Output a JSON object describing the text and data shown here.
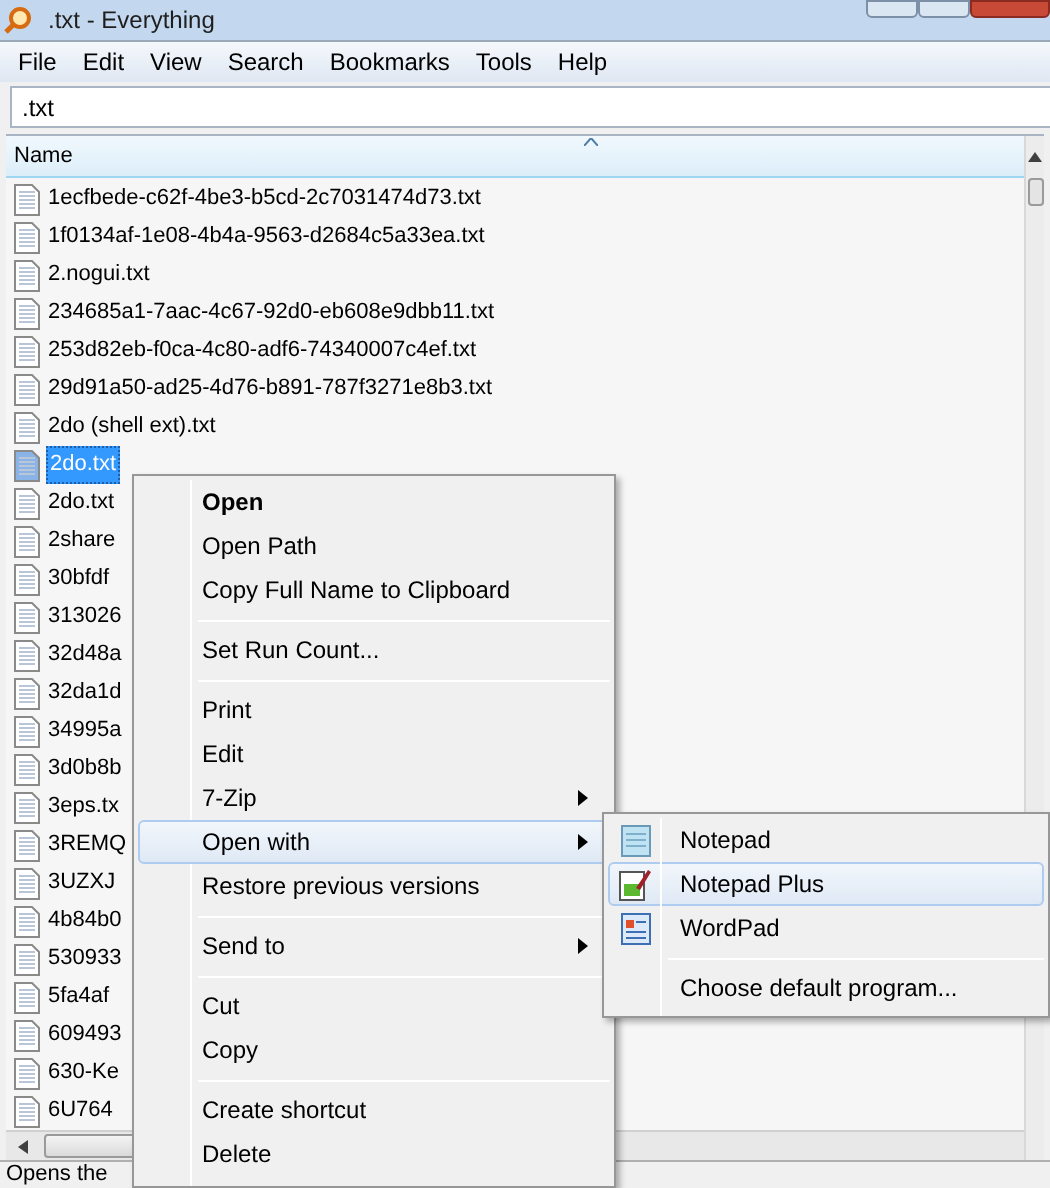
{
  "window": {
    "title": ".txt - Everything"
  },
  "menu_bar": [
    "File",
    "Edit",
    "View",
    "Search",
    "Bookmarks",
    "Tools",
    "Help"
  ],
  "search": {
    "value": ".txt"
  },
  "table": {
    "columns": [
      "Name"
    ],
    "rows": [
      {
        "name": "1ecfbede-c62f-4be3-b5cd-2c7031474d73.txt",
        "selected": false
      },
      {
        "name": "1f0134af-1e08-4b4a-9563-d2684c5a33ea.txt",
        "selected": false
      },
      {
        "name": "2.nogui.txt",
        "selected": false
      },
      {
        "name": "234685a1-7aac-4c67-92d0-eb608e9dbb11.txt",
        "selected": false
      },
      {
        "name": "253d82eb-f0ca-4c80-adf6-74340007c4ef.txt",
        "selected": false
      },
      {
        "name": "29d91a50-ad25-4d76-b891-787f3271e8b3.txt",
        "selected": false
      },
      {
        "name": "2do (shell ext).txt",
        "selected": false
      },
      {
        "name": "2do.txt",
        "selected": true
      },
      {
        "name": "2do.txt",
        "selected": false
      },
      {
        "name": "2share",
        "selected": false
      },
      {
        "name": "30bfdf",
        "selected": false
      },
      {
        "name": "313026",
        "selected": false
      },
      {
        "name": "32d48a",
        "selected": false
      },
      {
        "name": "32da1d",
        "selected": false
      },
      {
        "name": "34995a",
        "selected": false
      },
      {
        "name": "3d0b8b",
        "selected": false
      },
      {
        "name": "3eps.tx",
        "selected": false
      },
      {
        "name": "3REMQ",
        "selected": false
      },
      {
        "name": "3UZXJ",
        "selected": false
      },
      {
        "name": "4b84b0",
        "selected": false
      },
      {
        "name": "530933",
        "selected": false
      },
      {
        "name": "5fa4af",
        "selected": false
      },
      {
        "name": "609493",
        "selected": false
      },
      {
        "name": "630-Ke",
        "selected": false
      },
      {
        "name": "6U764",
        "selected": false
      }
    ]
  },
  "status_bar": "Opens the",
  "context_menu": {
    "items": [
      {
        "kind": "item",
        "label": "Open",
        "bold": true,
        "selected": false,
        "submenu": false
      },
      {
        "kind": "item",
        "label": "Open Path",
        "bold": false,
        "selected": false,
        "submenu": false
      },
      {
        "kind": "item",
        "label": "Copy Full Name to Clipboard",
        "bold": false,
        "selected": false,
        "submenu": false
      },
      {
        "kind": "separator"
      },
      {
        "kind": "item",
        "label": "Set Run Count...",
        "bold": false,
        "selected": false,
        "submenu": false
      },
      {
        "kind": "separator"
      },
      {
        "kind": "item",
        "label": "Print",
        "bold": false,
        "selected": false,
        "submenu": false
      },
      {
        "kind": "item",
        "label": "Edit",
        "bold": false,
        "selected": false,
        "submenu": false
      },
      {
        "kind": "item",
        "label": "7-Zip",
        "bold": false,
        "selected": false,
        "submenu": true
      },
      {
        "kind": "item",
        "label": "Open with",
        "bold": false,
        "selected": true,
        "submenu": true
      },
      {
        "kind": "item",
        "label": "Restore previous versions",
        "bold": false,
        "selected": false,
        "submenu": false
      },
      {
        "kind": "separator"
      },
      {
        "kind": "item",
        "label": "Send to",
        "bold": false,
        "selected": false,
        "submenu": true
      },
      {
        "kind": "separator"
      },
      {
        "kind": "item",
        "label": "Cut",
        "bold": false,
        "selected": false,
        "submenu": false
      },
      {
        "kind": "item",
        "label": "Copy",
        "bold": false,
        "selected": false,
        "submenu": false
      },
      {
        "kind": "separator"
      },
      {
        "kind": "item",
        "label": "Create shortcut",
        "bold": false,
        "selected": false,
        "submenu": false
      },
      {
        "kind": "item",
        "label": "Delete",
        "bold": false,
        "selected": false,
        "submenu": false
      }
    ]
  },
  "open_with_menu": {
    "items": [
      {
        "kind": "notepad",
        "label": "Notepad",
        "selected": false
      },
      {
        "kind": "notepad-plus",
        "label": "Notepad Plus",
        "selected": true
      },
      {
        "kind": "wordpad",
        "label": "WordPad",
        "selected": false
      },
      {
        "kind": "separator"
      },
      {
        "kind": "item",
        "label": "Choose default program...",
        "selected": false
      }
    ]
  }
}
